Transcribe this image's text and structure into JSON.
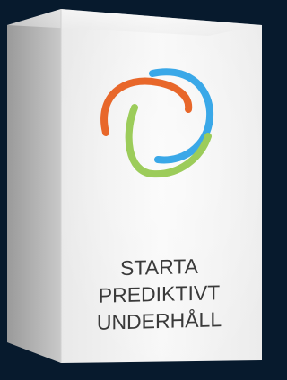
{
  "product_box": {
    "title_lines": [
      "STARTA",
      "PREDIKTIVT",
      "UNDERHÅLL"
    ],
    "logo_icon": "tri-color-swirl-logo",
    "colors": {
      "background": "#071a2d",
      "orange": "#e8672a",
      "blue": "#3aa8e8",
      "green": "#9ccc5a"
    }
  }
}
